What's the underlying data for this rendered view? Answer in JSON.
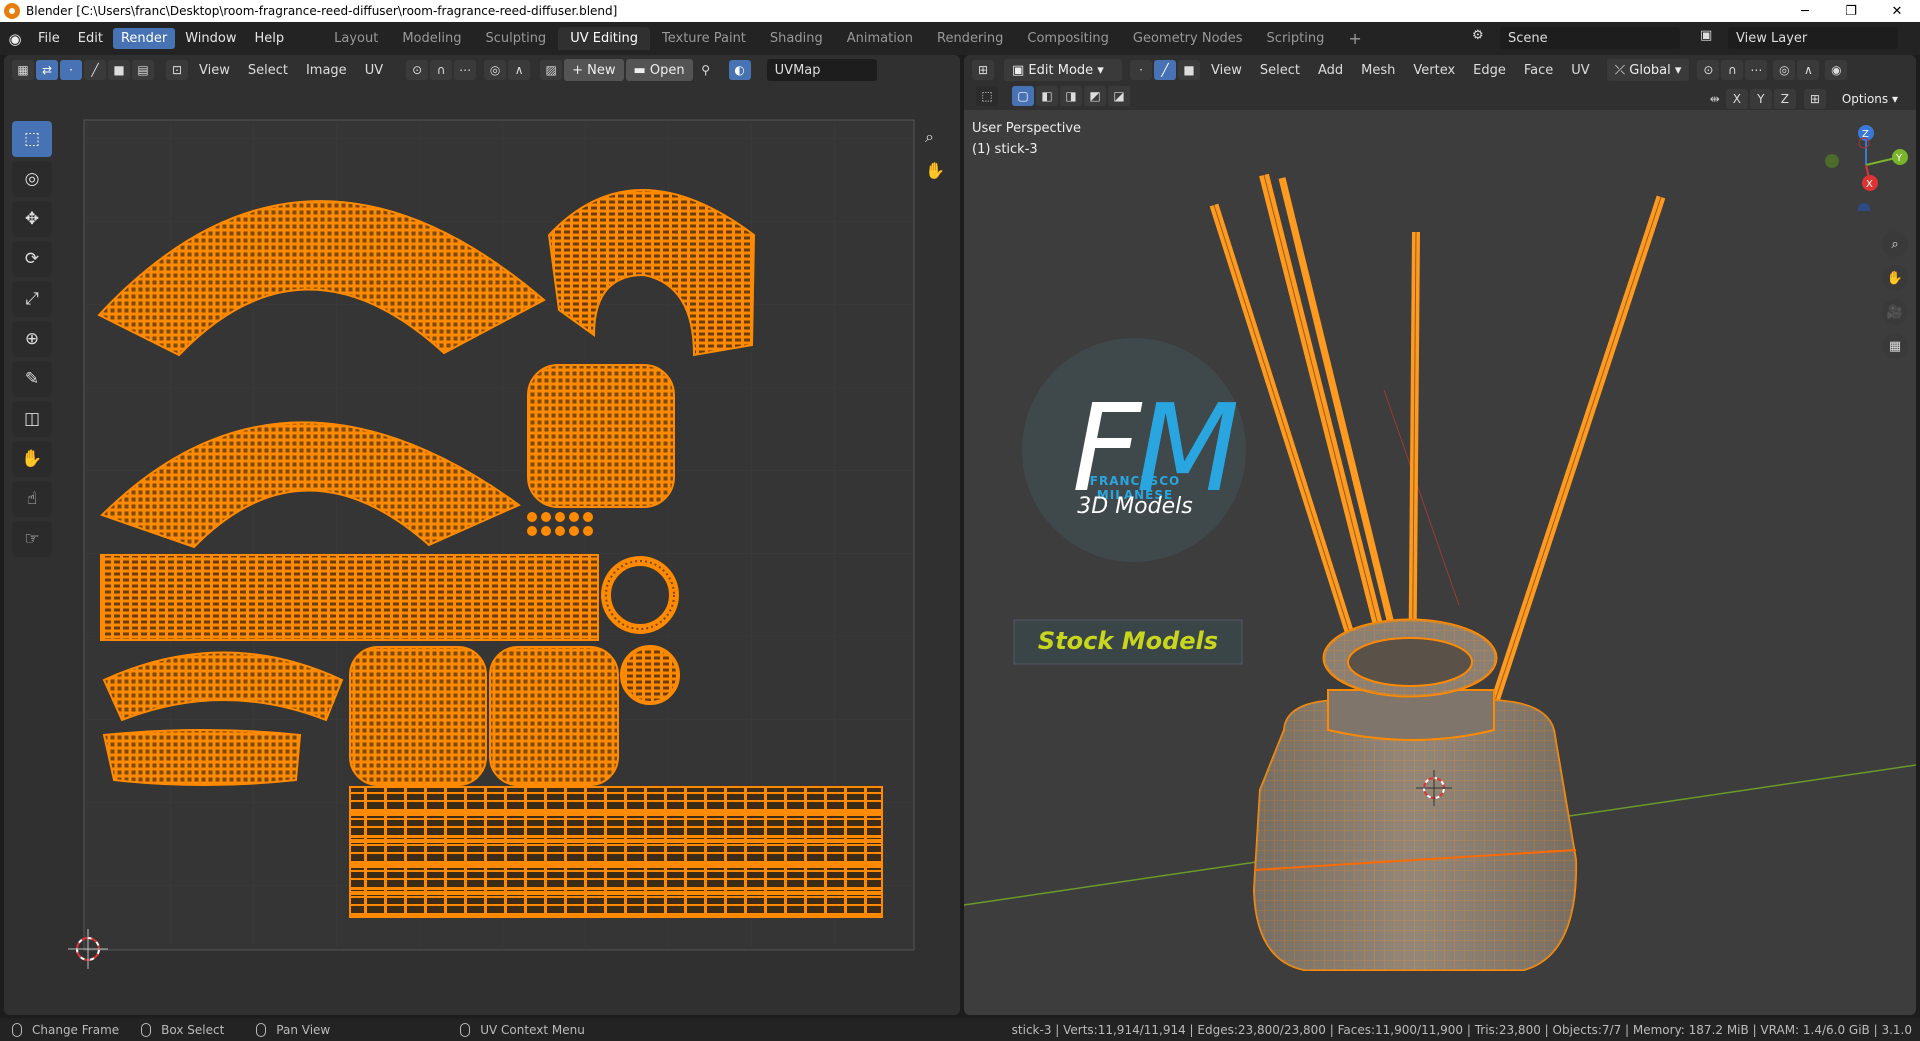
{
  "window": {
    "title": "Blender [C:\\Users\\franc\\Desktop\\room-fragrance-reed-diffuser\\room-fragrance-reed-diffuser.blend]",
    "minimize": "─",
    "maximize": "❐",
    "close": "✕"
  },
  "menu": [
    "File",
    "Edit",
    "Render",
    "Window",
    "Help"
  ],
  "workspaces": [
    "Layout",
    "Modeling",
    "Sculpting",
    "UV Editing",
    "Texture Paint",
    "Shading",
    "Animation",
    "Rendering",
    "Compositing",
    "Geometry Nodes",
    "Scripting"
  ],
  "active_workspace": "UV Editing",
  "add_workspace": "+",
  "scene": {
    "label": "Scene",
    "view_layer": "View Layer"
  },
  "uv_editor": {
    "menus": [
      "View",
      "Select",
      "Image",
      "UV"
    ],
    "new_label": "New",
    "open_label": "Open",
    "uvmap": "UVMap"
  },
  "viewport": {
    "mode": "Edit Mode",
    "menus": [
      "View",
      "Select",
      "Add",
      "Mesh",
      "Vertex",
      "Edge",
      "Face",
      "UV"
    ],
    "transform": "Global",
    "axes": [
      "X",
      "Y",
      "Z"
    ],
    "options": "Options",
    "perspective": "User Perspective",
    "object": "(1) stick-3",
    "gizmo_axes": {
      "z": "Z",
      "y": "Y",
      "x": "X"
    }
  },
  "watermark": {
    "initials": "FM",
    "name": "FRANCESCO MILANESE",
    "subtitle": "3D Models",
    "banner": "Stock Models"
  },
  "statusbar": {
    "hints": [
      "Change Frame",
      "Box Select",
      "Pan View",
      "UV Context Menu"
    ],
    "stats": "stick-3 | Verts:11,914/11,914 | Edges:23,800/23,800 | Faces:11,900/11,900 | Tris:23,800 | Objects:7/7 | Memory: 187.2 MiB | VRAM: 1.4/6.0 GiB | 3.1.0"
  },
  "colors": {
    "accent": "#4772b3",
    "uv_orange": "#ff8a00",
    "bg": "#303030"
  }
}
